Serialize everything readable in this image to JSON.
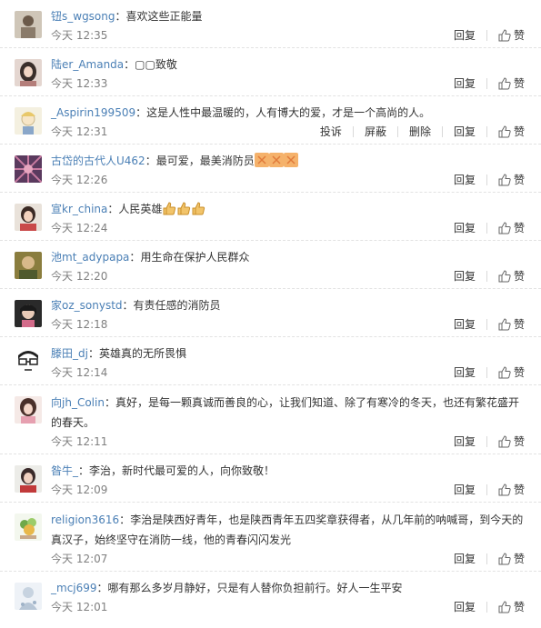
{
  "actions": {
    "reply": "回复",
    "like": "赞",
    "report": "投诉",
    "block": "屏蔽",
    "delete": "删除"
  },
  "comments": [
    {
      "user": "钮s_wgsong",
      "sep": "：",
      "text": "喜欢这些正能量",
      "time": "今天 12:35"
    },
    {
      "user": "陆er_Amanda",
      "sep": "：",
      "text": "▢▢致敬",
      "time": "今天 12:33"
    },
    {
      "user": "_Aspirin199509",
      "sep": "：",
      "text": "这是人性中最温暖的，人有博大的爱，才是一个高尚的人。",
      "time": "今天 12:31"
    },
    {
      "user": "古岱的古代人U462",
      "sep": "：",
      "text": "最可爱，最美消防员",
      "time": "今天 12:26"
    },
    {
      "user": "宣kr_china",
      "sep": "：",
      "text": "人民英雄",
      "time": "今天 12:24"
    },
    {
      "user": "池mt_adypapa",
      "sep": "：",
      "text": "用生命在保护人民群众",
      "time": "今天 12:20"
    },
    {
      "user": "家oz_sonystd",
      "sep": "：",
      "text": "有责任感的消防员",
      "time": "今天 12:18"
    },
    {
      "user": "滕田_dj",
      "sep": "：",
      "text": "英雄真的无所畏惧",
      "time": "今天 12:14"
    },
    {
      "user": "向jh_Colin",
      "sep": "：",
      "text": "真好，是每一颗真诚而善良的心，让我们知道、除了有寒冷的冬天，也还有繁花盛开的春天。",
      "time": "今天 12:11"
    },
    {
      "user": "昝牛_",
      "sep": "：",
      "text": "李治，新时代最可爱的人，向你致敬！",
      "time": "今天 12:09"
    },
    {
      "user": "religion3616",
      "sep": "：",
      "text": "李治是陕西好青年，也是陕西青年五四奖章获得者，从几年前的呐喊哥，到今天的真汉子，始终坚守在消防一线，他的青春闪闪发光",
      "time": "今天 12:07"
    },
    {
      "user": "_mcj699",
      "sep": "：",
      "text": "哪有那么多岁月静好，只是有人替你负担前行。好人一生平安",
      "time": "今天 12:01"
    }
  ],
  "colors": {
    "username": "#4a7fb5",
    "time": "#808080",
    "text": "#333333"
  },
  "icons": {
    "like": "thumbs-up-icon",
    "emoji_clap": "clap-emoji-icon",
    "emoji_thumb": "thumbs-emoji-icon"
  }
}
